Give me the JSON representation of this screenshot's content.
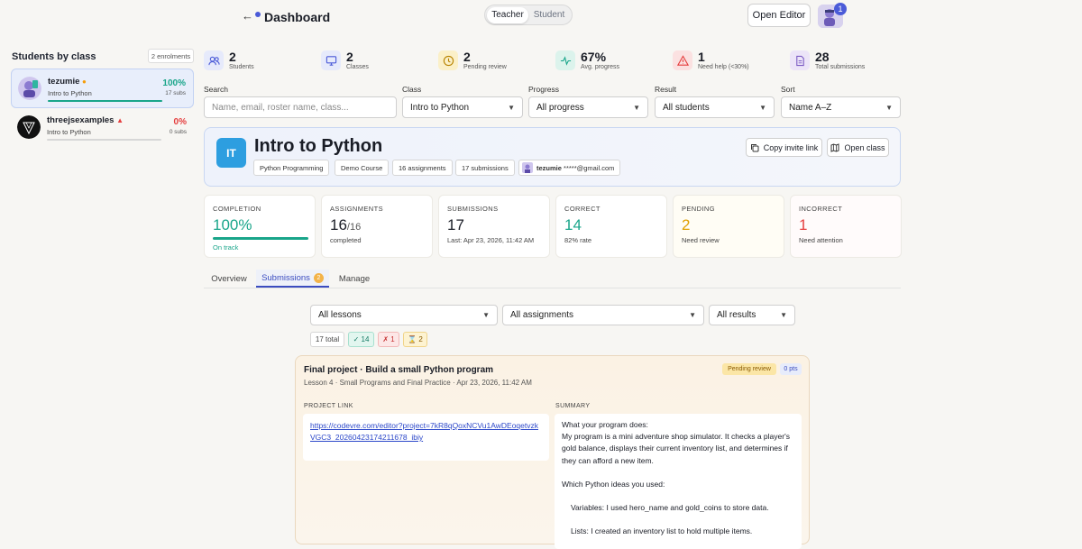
{
  "header": {
    "back_glyph": "←",
    "title": "Dashboard",
    "roles": [
      "Teacher",
      "Student"
    ],
    "active_role": "Teacher",
    "open_editor": "Open Editor",
    "notif_count": "1"
  },
  "sidebar": {
    "title": "Students by class",
    "enrollments": "2 enrolments",
    "students": [
      {
        "name": "tezumie",
        "class": "Intro to Python",
        "percent": "100%",
        "subs": "17 subs",
        "progress": 1.0,
        "status_color": "#f59e0b"
      },
      {
        "name": "threejsexamples",
        "class": "Intro to Python",
        "percent": "0%",
        "subs": "0 subs",
        "progress": 0.0,
        "status_color": "#e53e3e"
      }
    ]
  },
  "stats": [
    {
      "value": "2",
      "label": "Students",
      "icon": "users-icon",
      "color": "#4b5bd8"
    },
    {
      "value": "2",
      "label": "Classes",
      "icon": "monitor-icon",
      "color": "#4b5bd8"
    },
    {
      "value": "2",
      "label": "Pending review",
      "icon": "clock-icon",
      "color": "#d69e00"
    },
    {
      "value": "67%",
      "label": "Avg. progress",
      "icon": "activity-icon",
      "color": "#19a58a"
    },
    {
      "value": "1",
      "label": "Need help (<30%)",
      "icon": "alert-icon",
      "color": "#e53e3e"
    },
    {
      "value": "28",
      "label": "Total submissions",
      "icon": "document-icon",
      "color": "#7c5cc4"
    }
  ],
  "filters": {
    "search_label": "Search",
    "search_placeholder": "Name, email, roster name, class...",
    "class_label": "Class",
    "class_value": "Intro to Python",
    "progress_label": "Progress",
    "progress_value": "All progress",
    "result_label": "Result",
    "result_value": "All students",
    "sort_label": "Sort",
    "sort_value": "Name A–Z"
  },
  "class_header": {
    "initials": "IT",
    "title": "Intro to Python",
    "chips": [
      "Python Programming",
      "Demo Course",
      "16 assignments",
      "17 submissions"
    ],
    "owner_name": "tezumie",
    "owner_email": "*****@gmail.com",
    "copy_invite": "Copy invite link",
    "open_class": "Open class"
  },
  "metrics": [
    {
      "title": "COMPLETION",
      "value": "100%",
      "sub": "On track",
      "color": "#19a58a",
      "progress": 1.0
    },
    {
      "title": "ASSIGNMENTS",
      "value": "16",
      "value_suffix": "/16",
      "sub": "completed",
      "color": "#1a1d26"
    },
    {
      "title": "SUBMISSIONS",
      "value": "17",
      "sub": "Last: Apr 23, 2026, 11:42 AM",
      "color": "#1a1d26"
    },
    {
      "title": "CORRECT",
      "value": "14",
      "sub": "82% rate",
      "color": "#19a58a"
    },
    {
      "title": "PENDING",
      "value": "2",
      "sub": "Need review",
      "color": "#e0a000"
    },
    {
      "title": "INCORRECT",
      "value": "1",
      "sub": "Need attention",
      "color": "#e53e3e"
    }
  ],
  "tabs": [
    {
      "label": "Overview"
    },
    {
      "label": "Submissions",
      "badge": "2"
    },
    {
      "label": "Manage"
    }
  ],
  "active_tab": "Submissions",
  "submission_filters": {
    "lessons": "All lessons",
    "assignments": "All assignments",
    "results": "All results",
    "total": "17 total",
    "correct": "✓ 14",
    "incorrect": "✗ 1",
    "pending": "⌛ 2"
  },
  "submission": {
    "title": "Final project · Build a small Python program",
    "meta": "Lesson 4 · Small Programs and Final Practice · Apr 23, 2026, 11:42 AM",
    "status": "Pending review",
    "points": "0 pts",
    "project_link_label": "PROJECT LINK",
    "project_link": "https://codevre.com/editor?project=7kR8qQoxNCVu1AwDEoqetvzkVGC3_20260423174211678_ibiy",
    "summary_label": "SUMMARY",
    "summary": [
      "What your program does:",
      "My program is a mini adventure shop simulator. It checks a player's gold balance, displays their current inventory list, and determines if they can afford a new item.",
      "Which Python ideas you used:",
      "Variables: I used hero_name and gold_coins to store data.",
      "Lists: I created an inventory list to hold multiple items."
    ]
  }
}
